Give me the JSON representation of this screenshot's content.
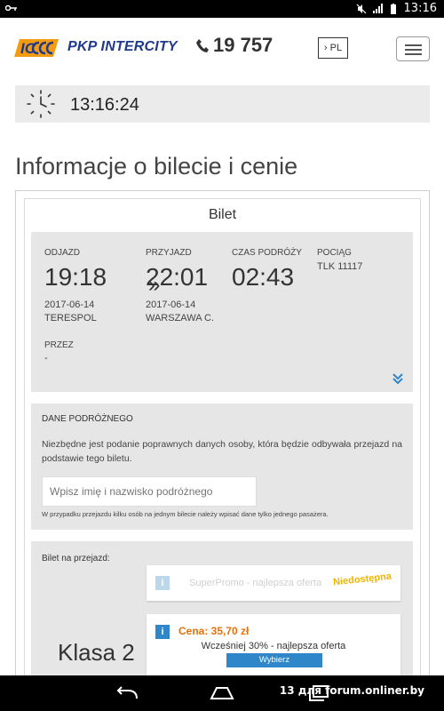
{
  "status_bar": {
    "time": "13:16"
  },
  "header": {
    "brand": "PKP INTERCITY",
    "phone": "19 757",
    "language": "› PL"
  },
  "clock": {
    "time": "13:16:24"
  },
  "page_title": "Informacje o bilecie i cenie",
  "card": {
    "title": "Bilet"
  },
  "journey": {
    "departure": {
      "label": "ODJAZD",
      "time": "19:18",
      "date": "2017-06-14",
      "station": "TERESPOL"
    },
    "arrow": "»",
    "arrival": {
      "label": "PRZYJAZD",
      "time": "22:01",
      "date": "2017-06-14",
      "station": "WARSZAWA C."
    },
    "duration": {
      "label": "CZAS PODRÓŻY",
      "time": "02:43"
    },
    "train": {
      "label": "POCIĄG",
      "value": "TLK 11117"
    },
    "via": {
      "label": "PRZEZ",
      "value": "-"
    }
  },
  "passenger": {
    "title": "DANE PODRÓŻNEGO",
    "text": "Niezbędne jest podanie poprawnych danych osoby, która będzie odbywała przejazd na podstawie tego biletu.",
    "input_placeholder": "Wpisz imię i nazwisko podróżnego",
    "note": "W przypadku przejazdu kilku osób na jednym bilecie należy wpisać dane tylko jednego pasażera."
  },
  "ticket": {
    "label": "Bilet na przejazd:",
    "class_label": "Klasa 2",
    "offers": [
      {
        "info": "i",
        "name": "SuperPromo - najlepsza oferta",
        "status": "Niedostępna"
      },
      {
        "info": "i",
        "price": "Cena: 35,70 zł",
        "name": "Wcześniej 30% - najlepsza oferta",
        "button": "Wybierz"
      }
    ]
  },
  "watermark": "13 для forum.onliner.by",
  "colors": {
    "accent_blue": "#2f86c9",
    "price_orange": "#e8700a",
    "unavailable_yellow": "#f0b400",
    "panel_gray": "#e6e6e6"
  }
}
